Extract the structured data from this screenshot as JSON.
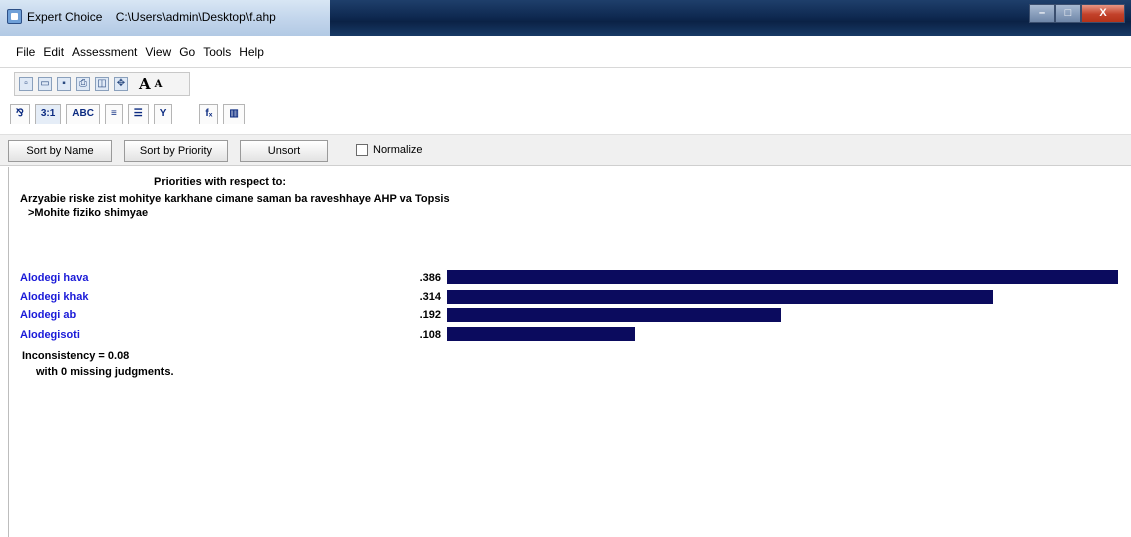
{
  "window": {
    "app_name": "Expert Choice",
    "file_path": "C:\\Users\\admin\\Desktop\\f.ahp",
    "minimize_symbol": "–",
    "maximize_symbol": "□",
    "close_symbol": "X"
  },
  "menu": {
    "items": [
      "File",
      "Edit",
      "Assessment",
      "View",
      "Go",
      "Tools",
      "Help"
    ]
  },
  "toolbar1": {
    "icons": [
      "new-file-icon",
      "open-folder-icon",
      "save-icon",
      "print-icon",
      "print-preview-icon",
      "navigate-icon"
    ],
    "big_font": "A",
    "small_font": "A"
  },
  "toolbar2": {
    "tabs": [
      "⅋",
      "3:1",
      "ABC",
      "≡",
      "☰",
      "Y",
      "fₓ",
      "▥"
    ]
  },
  "sortbar": {
    "sort_by_name": "Sort by Name",
    "sort_by_priority": "Sort by Priority",
    "unsort": "Unsort",
    "normalize": "Normalize"
  },
  "report": {
    "heading": "Priorities with respect to:",
    "goal": "Arzyabie riske zist mohitye karkhane cimane saman ba raveshhaye AHP va Topsis",
    "node": ">Mohite fiziko shimyae",
    "alternatives": [
      {
        "label": "Alodegi hava",
        "value": ".386",
        "priority": 0.386
      },
      {
        "label": "Alodegi khak",
        "value": ".314",
        "priority": 0.314
      },
      {
        "label": "Alodegi ab",
        "value": ".192",
        "priority": 0.192
      },
      {
        "label": "Alodegisoti",
        "value": ".108",
        "priority": 0.108
      }
    ],
    "bar_color": "#0b0b5e",
    "label_color": "#1a1ad8",
    "inconsistency": "Inconsistency = 0.08",
    "missing": "with 0  missing judgments."
  }
}
